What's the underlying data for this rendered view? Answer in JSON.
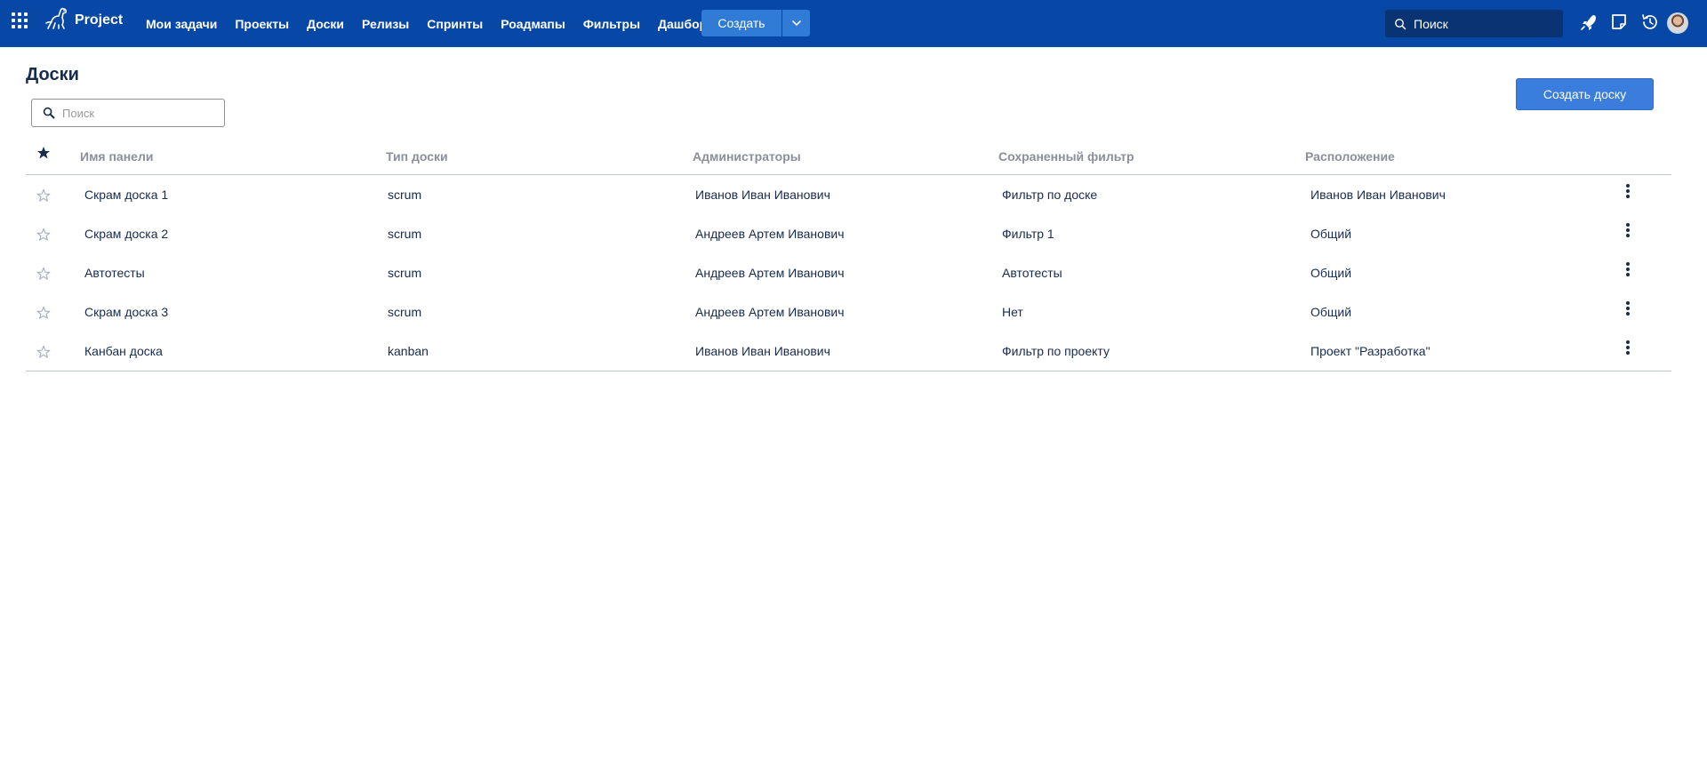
{
  "header": {
    "brand": "Project",
    "nav": [
      {
        "label": "Мои задачи"
      },
      {
        "label": "Проекты"
      },
      {
        "label": "Доски"
      },
      {
        "label": "Релизы"
      },
      {
        "label": "Спринты"
      },
      {
        "label": "Роадмапы"
      },
      {
        "label": "Фильтры"
      },
      {
        "label": "Дашборд"
      }
    ],
    "create_label": "Создать",
    "search_label": "Поиск",
    "colors": {
      "bar": "#0747a6",
      "create": "#2f7bd6",
      "search_bg": "#0a3373"
    }
  },
  "page": {
    "title": "Доски",
    "search_placeholder": "Поиск",
    "create_board_label": "Создать доску",
    "accent": "#3b7ddd"
  },
  "table": {
    "columns": [
      "Имя панели",
      "Тип доски",
      "Администраторы",
      "Сохраненный фильтр",
      "Расположение"
    ],
    "rows": [
      {
        "name": "Скрам доска 1",
        "type": "scrum",
        "admins": "Иванов Иван Иванович",
        "filter": "Фильтр по доске",
        "location": "Иванов Иван Иванович"
      },
      {
        "name": "Скрам доска 2",
        "type": "scrum",
        "admins": "Андреев Артем Иванович",
        "filter": "Фильтр 1",
        "location": "Общий"
      },
      {
        "name": "Автотесты",
        "type": "scrum",
        "admins": "Андреев Артем Иванович",
        "filter": "Автотесты",
        "location": "Общий"
      },
      {
        "name": "Скрам доска 3",
        "type": "scrum",
        "admins": "Андреев Артем Иванович",
        "filter": "Нет",
        "location": "Общий"
      },
      {
        "name": "Канбан доска",
        "type": "kanban",
        "admins": "Иванов Иван Иванович",
        "filter": "Фильтр по проекту",
        "location": "Проект \"Разработка\""
      }
    ]
  },
  "icons": [
    "apps-grid-icon",
    "dino-logo-icon",
    "chevron-down-icon",
    "search-icon",
    "rocket-icon",
    "notes-icon",
    "history-icon",
    "user-avatar",
    "star-filled-icon",
    "star-outline-icon",
    "more-vertical-icon"
  ]
}
